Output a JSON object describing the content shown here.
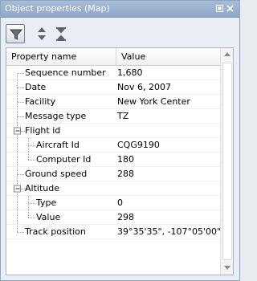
{
  "window": {
    "title": "Object properties (Map)"
  },
  "toolbar": {
    "buttons": [
      {
        "icon": "filter-icon"
      },
      {
        "icon": "expand-all-icon"
      },
      {
        "icon": "collapse-all-icon"
      }
    ]
  },
  "grid": {
    "columns": [
      "Property name",
      "Value"
    ],
    "rows": [
      {
        "name": "Sequence number",
        "value": "1,680",
        "level": 0
      },
      {
        "name": "Date",
        "value": "Nov 6, 2007",
        "level": 0
      },
      {
        "name": "Facility",
        "value": "New York Center",
        "level": 0
      },
      {
        "name": "Message type",
        "value": "TZ",
        "level": 0
      },
      {
        "name": "Flight id",
        "value": "",
        "level": 0,
        "expandable": true,
        "expanded": true
      },
      {
        "name": "Aircraft Id",
        "value": "CQG9190",
        "level": 1
      },
      {
        "name": "Computer Id",
        "value": "180",
        "level": 1
      },
      {
        "name": "Ground speed",
        "value": "288",
        "level": 0
      },
      {
        "name": "Altitude",
        "value": "",
        "level": 0,
        "expandable": true,
        "expanded": true
      },
      {
        "name": "Type",
        "value": "0",
        "level": 1
      },
      {
        "name": "Value",
        "value": "298",
        "level": 1
      },
      {
        "name": "Track position",
        "value": "39°35'35\", -107°05'00\"",
        "level": 0
      }
    ]
  }
}
